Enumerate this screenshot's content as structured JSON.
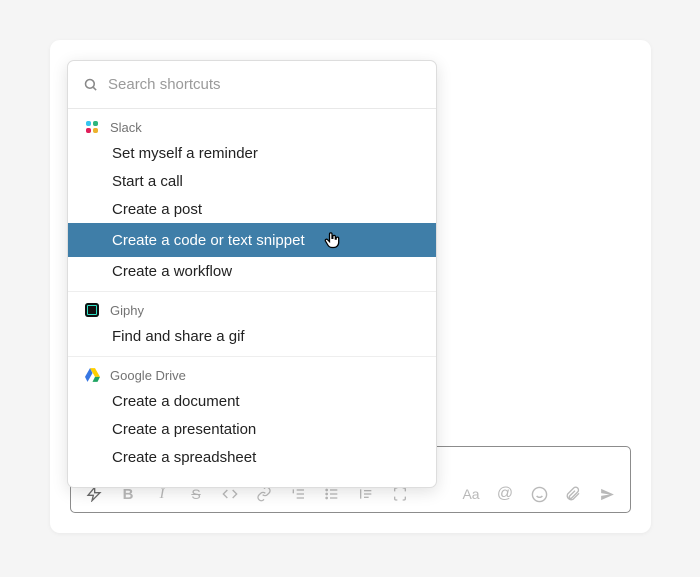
{
  "search": {
    "placeholder": "Search shortcuts"
  },
  "sections": {
    "slack": {
      "name": "Slack",
      "items": [
        "Set myself a reminder",
        "Start a call",
        "Create a post",
        "Create a code or text snippet",
        "Create a workflow"
      ]
    },
    "giphy": {
      "name": "Giphy",
      "items": [
        "Find and share a gif"
      ]
    },
    "gdrive": {
      "name": "Google Drive",
      "items": [
        "Create a document",
        "Create a presentation",
        "Create a spreadsheet"
      ]
    }
  }
}
